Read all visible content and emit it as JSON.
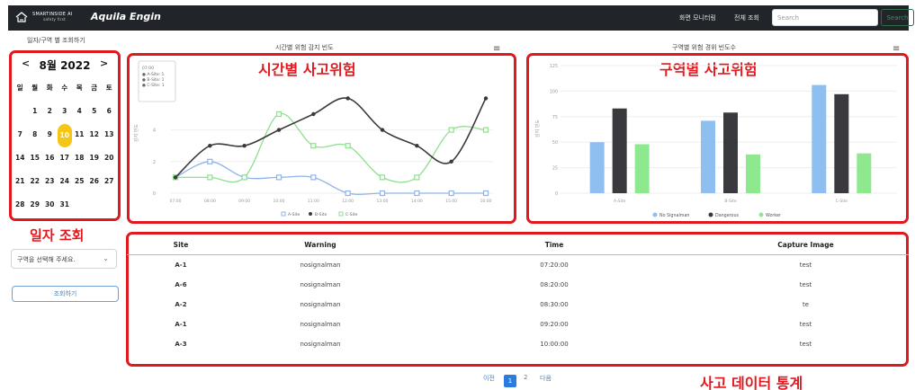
{
  "navbar": {
    "brand_small": "SMARTINSIDE AI",
    "brand_small_sub": "safety first",
    "brand_name": "Aquila Engin",
    "link_monitor": "화면 모니터링",
    "link_overall": "전체 조회",
    "search_placeholder": "Search",
    "search_button": "Search"
  },
  "sidebar": {
    "caption": "일자/구역 별 조회하기",
    "calendar": {
      "prev": "<",
      "next": ">",
      "title": "8월 2022",
      "weekdays": [
        "일",
        "월",
        "화",
        "수",
        "목",
        "금",
        "토"
      ],
      "weeks": [
        [
          "",
          "1",
          "2",
          "3",
          "4",
          "5",
          "6"
        ],
        [
          "7",
          "8",
          "9",
          "10",
          "11",
          "12",
          "13"
        ],
        [
          "14",
          "15",
          "16",
          "17",
          "18",
          "19",
          "20"
        ],
        [
          "21",
          "22",
          "23",
          "24",
          "25",
          "26",
          "27"
        ],
        [
          "28",
          "29",
          "30",
          "31",
          "",
          "",
          ""
        ]
      ],
      "selected_day": "10"
    },
    "date_query_label": "일자 조회",
    "zone_select_value": "구역을 선택해 주세요.",
    "query_button": "조회하기"
  },
  "time_chart": {
    "caption": "시간별 위험 감지 빈도",
    "annotation": "시간별 사고위험",
    "tooltip_title": "07:00",
    "tooltip_lines": [
      "A-Site: 1",
      "B-Site: 1",
      "C-Site: 1"
    ]
  },
  "zone_chart": {
    "caption": "구역별 위험 경위 빈도수",
    "annotation": "구역별 사고위험"
  },
  "chart_data": [
    {
      "type": "line",
      "title": "시간별 위험 감지 빈도",
      "categories": [
        "07:00",
        "08:00",
        "09:00",
        "10:00",
        "11:00",
        "12:00",
        "13:00",
        "14:00",
        "15:00",
        "16:00"
      ],
      "ylim": [
        0,
        7.5
      ],
      "yticks": [
        0,
        2,
        4
      ],
      "ylabel": "감지 빈도",
      "series": [
        {
          "name": "A-Site",
          "color": "#8fb3e8",
          "values": [
            1,
            2,
            1,
            1,
            1,
            0,
            0,
            0,
            0,
            0
          ]
        },
        {
          "name": "B-Site",
          "color": "#3a3a3a",
          "values": [
            1,
            3,
            3,
            4,
            5,
            6,
            4,
            3,
            2,
            6
          ]
        },
        {
          "name": "C-Site",
          "color": "#8ee08e",
          "values": [
            1,
            1,
            1,
            5,
            3,
            3,
            1,
            1,
            4,
            4
          ]
        }
      ],
      "legend_position": "bottom"
    },
    {
      "type": "bar",
      "title": "구역별 위험 경위 빈도수",
      "categories": [
        "A-Site",
        "B-Site",
        "C-Site"
      ],
      "ylim": [
        0,
        125
      ],
      "yticks": [
        0,
        25,
        50,
        75,
        100,
        125
      ],
      "ylabel": "감지 빈도",
      "series": [
        {
          "name": "No Signalman",
          "color": "#8fbff0",
          "values": [
            50,
            71,
            106
          ]
        },
        {
          "name": "Dangerous",
          "color": "#3a3a3e",
          "values": [
            83,
            79,
            97
          ]
        },
        {
          "name": "Worker",
          "color": "#8ee88e",
          "values": [
            48,
            38,
            39
          ]
        }
      ],
      "legend_position": "bottom"
    }
  ],
  "table": {
    "headers": [
      "Site",
      "Warning",
      "Time",
      "Capture Image"
    ],
    "rows": [
      [
        "A-1",
        "nosignalman",
        "07:20:00",
        "test"
      ],
      [
        "A-6",
        "nosignalman",
        "08:20:00",
        "test"
      ],
      [
        "A-2",
        "nosignalman",
        "08:30:00",
        "te"
      ],
      [
        "A-1",
        "nosignalman",
        "09:20:00",
        "test"
      ],
      [
        "A-3",
        "nosignalman",
        "10:00:00",
        "test"
      ]
    ],
    "annotation": "사고 데이터 통계"
  },
  "pagination": {
    "prev": "이전",
    "current": "1",
    "page2": "2",
    "next": "다음"
  },
  "colors": {
    "navbar_bg": "#212529",
    "highlight_red": "#e0191f",
    "selected_day": "#f5c518",
    "primary_blue": "#2b7be0"
  }
}
